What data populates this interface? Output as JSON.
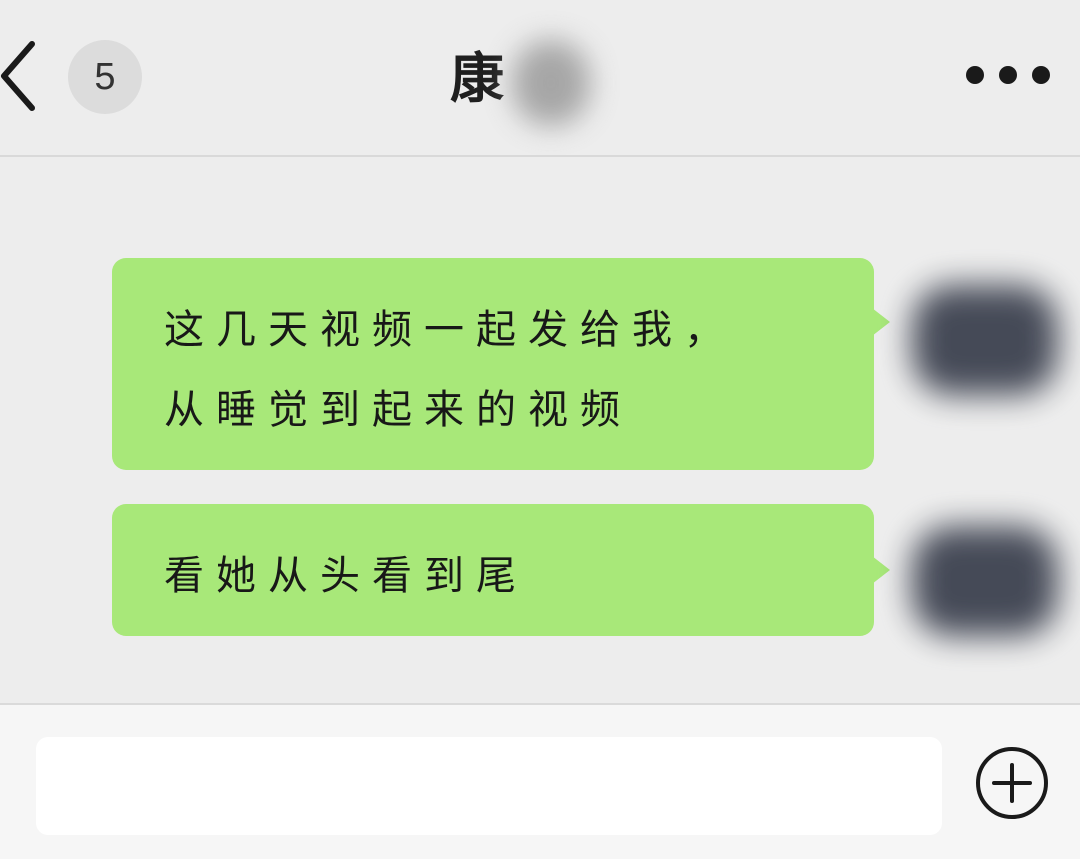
{
  "header": {
    "unread_count": "5",
    "title": "康"
  },
  "messages": [
    {
      "line1": "这几天视频一起发给我，",
      "line2": "从睡觉到起来的视频"
    },
    {
      "line1": "看她从头看到尾"
    }
  ],
  "colors": {
    "bubble": "#a8e879",
    "background": "#ededed"
  },
  "icons": {
    "back": "chevron-left-icon",
    "more": "more-dots-icon",
    "plus": "plus-circle-icon"
  }
}
